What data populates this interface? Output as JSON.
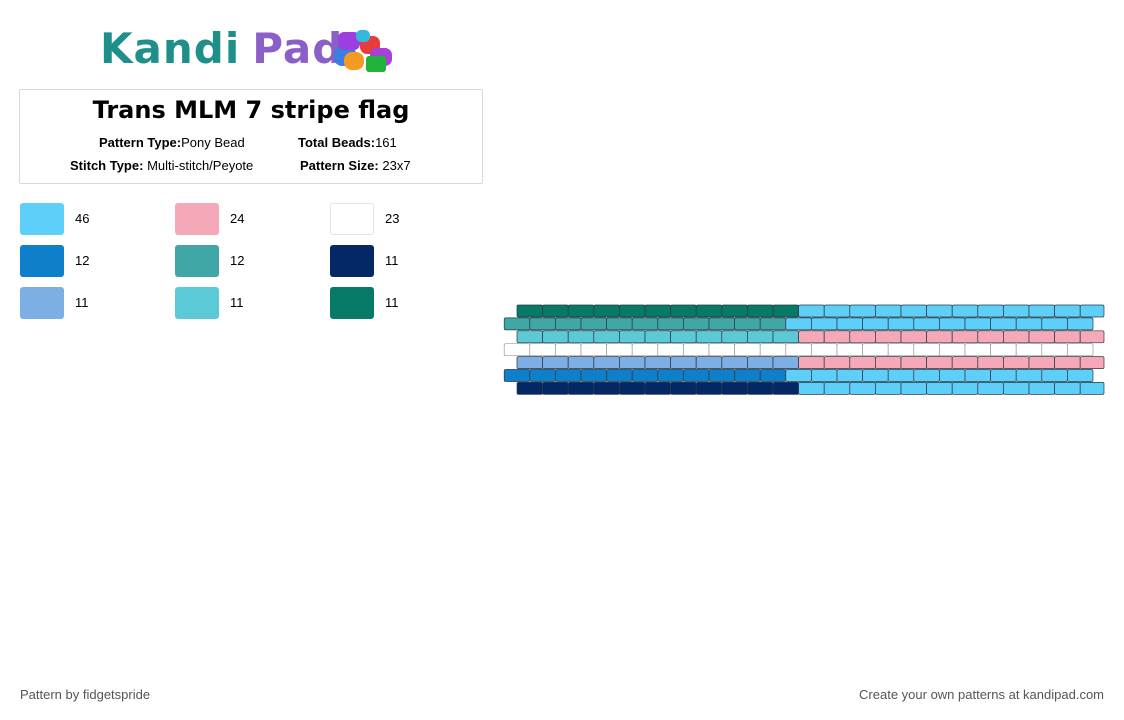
{
  "brand": {
    "part1": "Kandi",
    "part2": "Pad",
    "logo_icon": "beads-icon"
  },
  "pattern": {
    "title": "Trans MLM 7 stripe flag",
    "type_label": "Pattern Type:",
    "type_value": "Pony Bead",
    "beads_label": "Total Beads:",
    "beads_value": "161",
    "stitch_label": "Stitch Type:",
    "stitch_value": "Multi-stitch/Peyote",
    "size_label": "Pattern Size:",
    "size_value": "23x7"
  },
  "palette": [
    {
      "color": "#5dcff8",
      "count": "46"
    },
    {
      "color": "#f5a9b8",
      "count": "24"
    },
    {
      "color": "#ffffff",
      "count": "23"
    },
    {
      "color": "#0f7fcc",
      "count": "12"
    },
    {
      "color": "#41a6a6",
      "count": "12"
    },
    {
      "color": "#042866",
      "count": "11"
    },
    {
      "color": "#7daee4",
      "count": "11"
    },
    {
      "color": "#5ccad6",
      "count": "11"
    },
    {
      "color": "#067a67",
      "count": "11"
    }
  ],
  "grid": {
    "columns": 23,
    "rows": [
      {
        "left": "#067a67",
        "right": "#5dcff8"
      },
      {
        "left": "#41a6a6",
        "right": "#5dcff8"
      },
      {
        "left": "#5ccad6",
        "right": "#f5a9b8"
      },
      {
        "left": "#ffffff",
        "right": "#ffffff"
      },
      {
        "left": "#7daee4",
        "right": "#f5a9b8"
      },
      {
        "left": "#0f7fcc",
        "right": "#5dcff8"
      },
      {
        "left": "#042866",
        "right": "#5dcff8"
      }
    ]
  },
  "footer": {
    "credit": "Pattern by fidgetspride",
    "cta": "Create your own patterns at kandipad.com"
  }
}
